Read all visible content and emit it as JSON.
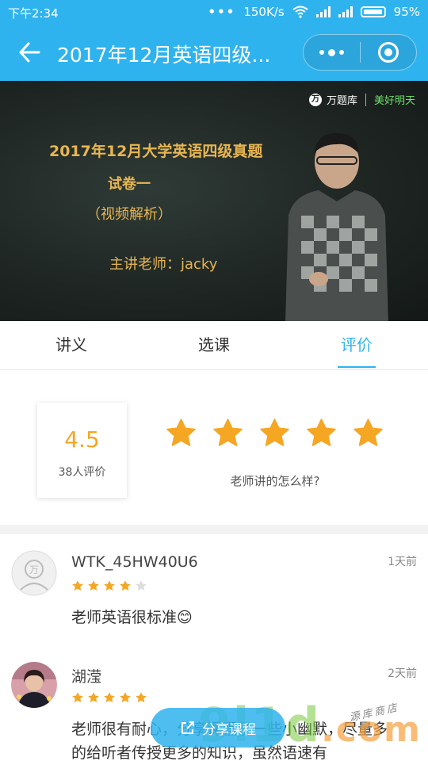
{
  "status_bar": {
    "time": "下午2:34",
    "network_speed": "150K/s",
    "battery": "95%"
  },
  "nav": {
    "title": "2017年12月英语四级..."
  },
  "video": {
    "brand_name": "万题库",
    "brand_slogan": "美好明天",
    "title": "2017年12月大学英语四级真题",
    "subtitle": "试卷一",
    "subtitle2": "（视频解析）",
    "teacher": "主讲老师：jacky"
  },
  "tabs": [
    {
      "label": "讲义"
    },
    {
      "label": "选课"
    },
    {
      "label": "评价"
    }
  ],
  "rating": {
    "score": "4.5",
    "count_label": "38人评价",
    "question": "老师讲的怎么样?"
  },
  "reviews": [
    {
      "name": "WTK_45HW40U6",
      "date": "1天前",
      "stars": 4,
      "text": "老师英语很标准😊"
    },
    {
      "name": "湖滢",
      "date": "2天前",
      "stars": 5,
      "text": "老师很有耐心，分享课程了一些小幽默，尽量多的给听者传授更多的知识，虽然语速有"
    }
  ],
  "share": {
    "label": "分享课程"
  },
  "watermark": {
    "text": "9l1d",
    "suffix": ".com",
    "shop": "源库商店"
  },
  "colors": {
    "accent": "#2fb3ee",
    "star": "#f5a623",
    "star_empty": "#dddddd"
  }
}
